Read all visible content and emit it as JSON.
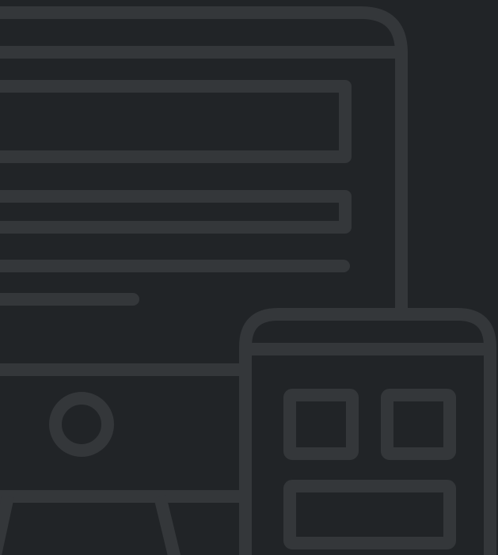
{
  "illustration": {
    "description_icons": [
      "monitor-icon",
      "mobile-device-icon"
    ],
    "colors": {
      "background": "#212427",
      "line": "#34373a"
    }
  }
}
